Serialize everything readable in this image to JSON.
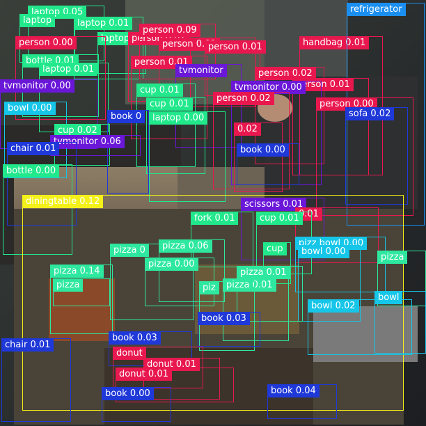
{
  "image": {
    "description_icon": "photo-icon",
    "colors": {
      "person": "#e8184f",
      "laptop": "#22e88c",
      "tvmonitor": "#6a17d8",
      "cup": "#22e88c",
      "book": "#1f38d8",
      "bowl": "#16c6e8",
      "chair": "#1f38d8",
      "bottle": "#22e88c",
      "diningtable": "#f4f01a",
      "pizza": "#2ee8a0",
      "donut": "#e8184f",
      "handbag": "#e8184f",
      "refrigerator": "#1b8ff0",
      "sofa": "#1f38d8",
      "scissors": "#6a17d8",
      "fork": "#22e88c"
    }
  },
  "detections": [
    {
      "label": "laptop 0.05",
      "cls": "laptop"
    },
    {
      "label": "laptop",
      "cls": "laptop"
    },
    {
      "label": "laptop 0.01",
      "cls": "laptop"
    },
    {
      "label": "laptop",
      "cls": "laptop"
    },
    {
      "label": "person 0.01",
      "cls": "person"
    },
    {
      "label": "person 0.09",
      "cls": "person"
    },
    {
      "label": "person 0.00",
      "cls": "person"
    },
    {
      "label": "person 0.01",
      "cls": "person"
    },
    {
      "label": "person 0.01",
      "cls": "person"
    },
    {
      "label": "handbag 0.01",
      "cls": "handbag"
    },
    {
      "label": "refrigerator",
      "cls": "refrigerator"
    },
    {
      "label": "bottle 0.01",
      "cls": "bottle"
    },
    {
      "label": "laptop 0.01",
      "cls": "laptop"
    },
    {
      "label": "person 0.01",
      "cls": "person"
    },
    {
      "label": "tvmonitor",
      "cls": "tvmonitor"
    },
    {
      "label": "person 0.02",
      "cls": "person"
    },
    {
      "label": "person 0.01",
      "cls": "person"
    },
    {
      "label": "tvmonitor 0.00",
      "cls": "tvmonitor"
    },
    {
      "label": "tvmonitor 0.00",
      "cls": "tvmonitor"
    },
    {
      "label": "cup 0.01",
      "cls": "cup"
    },
    {
      "label": "cup 0.01",
      "cls": "cup"
    },
    {
      "label": "person 0.02",
      "cls": "person"
    },
    {
      "label": "person 0.00",
      "cls": "person"
    },
    {
      "label": "sofa 0.02",
      "cls": "sofa"
    },
    {
      "label": "bowl 0.00",
      "cls": "bowl"
    },
    {
      "label": "book 0",
      "cls": "book"
    },
    {
      "label": "laptop 0.00",
      "cls": "laptop"
    },
    {
      "label": "cup 0.02",
      "cls": "cup"
    },
    {
      "label": "tvmonitor 0.06",
      "cls": "tvmonitor"
    },
    {
      "label": "0.02",
      "cls": "person"
    },
    {
      "label": "chair 0.01",
      "cls": "chair"
    },
    {
      "label": "book 0.00",
      "cls": "book"
    },
    {
      "label": "bottle 0.00",
      "cls": "bottle"
    },
    {
      "label": "diningtable 0.12",
      "cls": "diningtable"
    },
    {
      "label": "scissors 0.01",
      "cls": "scissors"
    },
    {
      "label": "0.01",
      "cls": "person"
    },
    {
      "label": "fork 0.01",
      "cls": "fork"
    },
    {
      "label": "cup 0.01",
      "cls": "cup"
    },
    {
      "label": "pizza 0",
      "cls": "pizza"
    },
    {
      "label": "pizza 0.06",
      "cls": "pizza"
    },
    {
      "label": "cup",
      "cls": "cup"
    },
    {
      "label": "pizz bowl 0.00",
      "cls": "bowl"
    },
    {
      "label": "bowl 0.00",
      "cls": "bowl"
    },
    {
      "label": "pizza",
      "cls": "pizza"
    },
    {
      "label": "pizza 0.14",
      "cls": "pizza"
    },
    {
      "label": "pizza 0.00",
      "cls": "pizza"
    },
    {
      "label": "pizza 0.01",
      "cls": "pizza"
    },
    {
      "label": "pizza 0.01",
      "cls": "pizza"
    },
    {
      "label": "piz",
      "cls": "pizza"
    },
    {
      "label": "pizza",
      "cls": "pizza"
    },
    {
      "label": "bowl 0.02",
      "cls": "bowl"
    },
    {
      "label": "bowl",
      "cls": "bowl"
    },
    {
      "label": "book 0.03",
      "cls": "book"
    },
    {
      "label": "chair 0.01",
      "cls": "chair"
    },
    {
      "label": "book 0.03",
      "cls": "book"
    },
    {
      "label": "donut",
      "cls": "donut"
    },
    {
      "label": "donut 0.01",
      "cls": "donut"
    },
    {
      "label": "donut 0.01",
      "cls": "donut"
    },
    {
      "label": "book 0.00",
      "cls": "book"
    },
    {
      "label": "book 0.04",
      "cls": "book"
    }
  ]
}
